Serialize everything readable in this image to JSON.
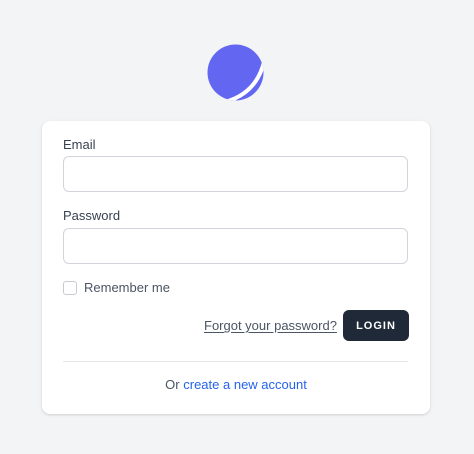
{
  "logo": {
    "icon": "planet-logo-icon",
    "color": "#6366f1"
  },
  "form": {
    "email_label": "Email",
    "email_value": "",
    "password_label": "Password",
    "password_value": "",
    "remember_label": "Remember me",
    "remember_checked": false,
    "forgot_link": "Forgot your password?",
    "login_button": "LOGIN"
  },
  "footer": {
    "prefix": "Or",
    "create_link": "create a new account"
  },
  "colors": {
    "background": "#f3f4f6",
    "card": "#ffffff",
    "button": "#1f2937",
    "link": "#2563eb",
    "logo": "#6366f1"
  }
}
